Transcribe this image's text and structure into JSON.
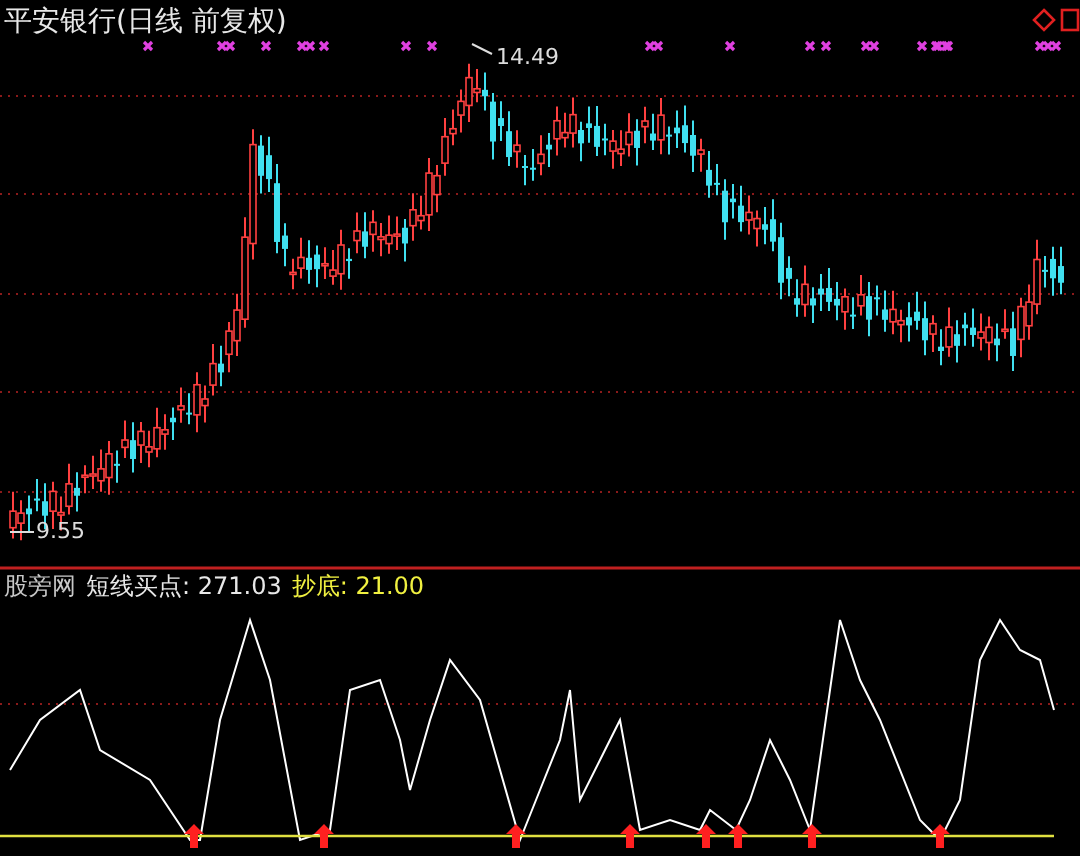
{
  "chart_title": "平安银行(日线 前复权)",
  "price_annotations": [
    {
      "kind": "high",
      "text": "14.49"
    },
    {
      "kind": "low",
      "text": "9.55"
    }
  ],
  "indicator": {
    "name": "股旁网",
    "items": [
      {
        "kind": "main",
        "text": "短线买点: 271.03"
      },
      {
        "kind": "signal",
        "text": "抄底: 21.00"
      }
    ]
  }
}
